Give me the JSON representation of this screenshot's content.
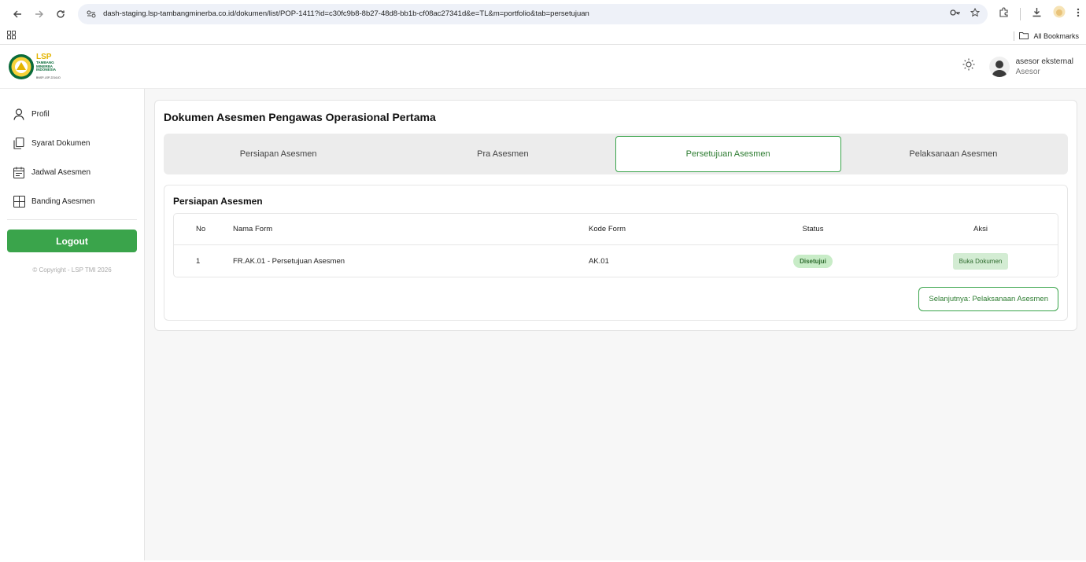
{
  "browser": {
    "url": "dash-staging.lsp-tambangminerba.co.id/dokumen/list/POP-1411?id=c30fc9b8-8b27-48d8-bb1b-cf08ac27341d&e=TL&m=portfolio&tab=persetujuan",
    "bookmarks_label": "All Bookmarks"
  },
  "header": {
    "logo": {
      "title": "LSP",
      "line1": "TAMBANG",
      "line2": "MINERBA",
      "line3": "INDONESIA",
      "reg": "BNSP-LSP-2216-ID"
    },
    "user_name": "asesor eksternal",
    "user_role": "Asesor"
  },
  "sidebar": {
    "items": [
      {
        "label": "Profil",
        "icon": "user-icon"
      },
      {
        "label": "Syarat Dokumen",
        "icon": "documents-icon"
      },
      {
        "label": "Jadwal Asesmen",
        "icon": "calendar-icon"
      },
      {
        "label": "Banding Asesmen",
        "icon": "layout-icon"
      }
    ],
    "logout_label": "Logout",
    "copyright": "© Copyright - LSP TMI 2026"
  },
  "main": {
    "title": "Dokumen Asesmen Pengawas Operasional Pertama",
    "tabs": [
      {
        "label": "Persiapan Asesmen",
        "active": false
      },
      {
        "label": "Pra Asesmen",
        "active": false
      },
      {
        "label": "Persetujuan Asesmen",
        "active": true
      },
      {
        "label": "Pelaksanaan Asesmen",
        "active": false
      }
    ],
    "section_title": "Persiapan Asesmen",
    "table": {
      "headers": {
        "no": "No",
        "name": "Nama Form",
        "kode": "Kode Form",
        "status": "Status",
        "aksi": "Aksi"
      },
      "rows": [
        {
          "no": "1",
          "name": "FR.AK.01 - Persetujuan Asesmen",
          "kode": "AK.01",
          "status": "Disetujui",
          "action": "Buka Dokumen"
        }
      ]
    },
    "next_label": "Selanjutnya: Pelaksanaan Asesmen"
  },
  "colors": {
    "accent": "#3aa44b",
    "accent_text": "#2e7d32",
    "badge_bg": "#c8ecc7"
  }
}
